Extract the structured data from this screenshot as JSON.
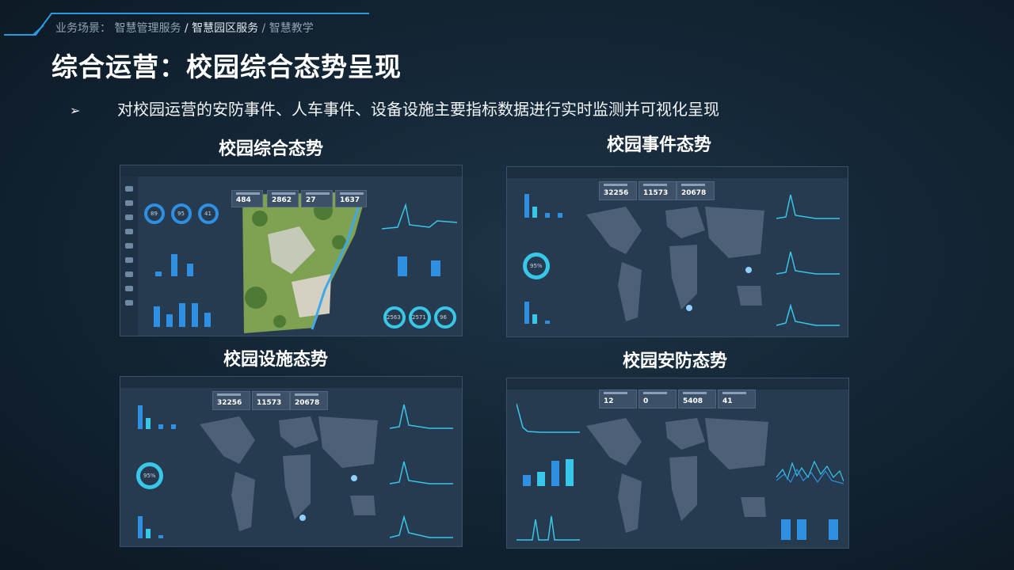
{
  "header": {
    "breadcrumb_prefix": "业务场景：",
    "breadcrumb_item1": "智慧管理服务",
    "breadcrumb_sep1": " / ",
    "breadcrumb_item2": "智慧园区服务",
    "breadcrumb_sep2": "/",
    "breadcrumb_item3": "智慧教学",
    "title": "综合运营：校园综合态势呈现"
  },
  "bullet": {
    "icon": "arrow-bullet-icon",
    "text": "对校园运营的安防事件、人车事件、设备设施主要指标数据进行实时监测并可视化呈现"
  },
  "panels": {
    "comprehensive": {
      "title": "校园综合态势",
      "stats": [
        "484",
        "2862",
        "27",
        "1637"
      ],
      "rings": [
        "89",
        "95",
        "41"
      ],
      "bottom_rings": [
        "2563",
        "2571",
        "96"
      ]
    },
    "events": {
      "title": "校园事件态势",
      "stats": [
        "32256",
        "11573",
        "20678"
      ],
      "ring": "95%"
    },
    "facilities": {
      "title": "校园设施态势",
      "stats": [
        "32256",
        "11573",
        "20678"
      ],
      "ring": "95%"
    },
    "security": {
      "title": "校园安防态势",
      "stats": [
        "12",
        "0",
        "5408",
        "41"
      ]
    }
  },
  "colors": {
    "accent": "#2f8fe0",
    "cyan": "#38c7e8",
    "background": "#142636"
  }
}
